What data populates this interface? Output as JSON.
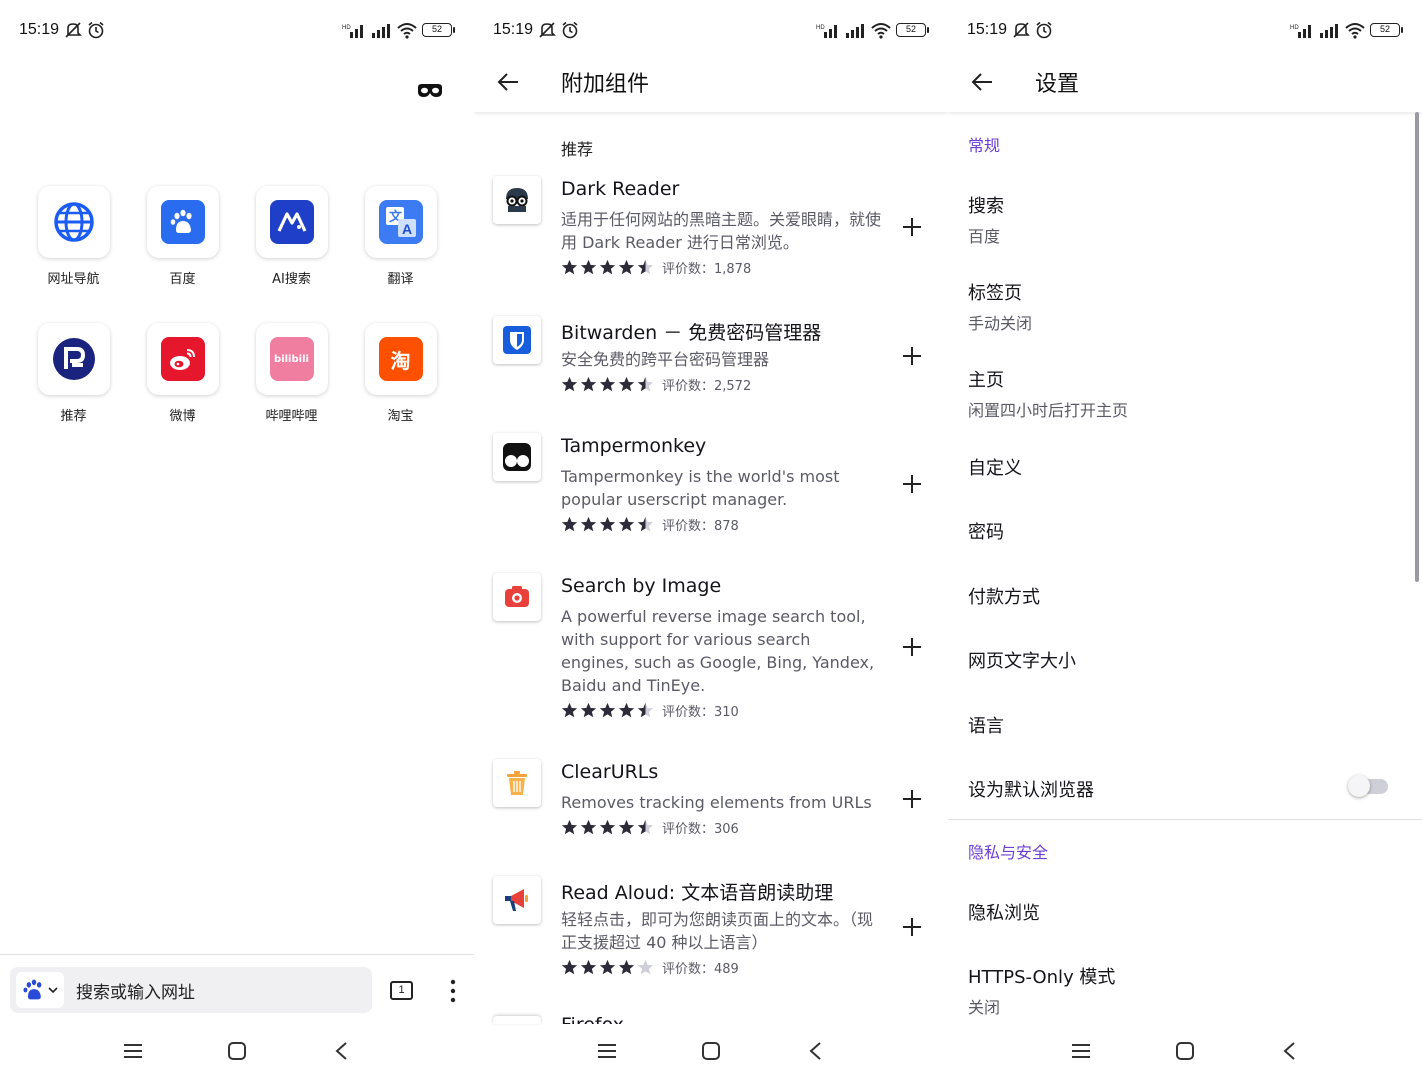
{
  "status_bar": {
    "time": "15:19",
    "battery": "52"
  },
  "home": {
    "shortcuts": [
      {
        "label": "网址导航",
        "icon": "globe-icon",
        "color": "#1a5cf5"
      },
      {
        "label": "百度",
        "icon": "baidu-paw-icon",
        "color": "#2a6cf0"
      },
      {
        "label": "AI搜索",
        "icon": "ai-search-icon",
        "color": "#1f3fc8"
      },
      {
        "label": "翻译",
        "icon": "translate-icon",
        "color": "#3d7bf2"
      },
      {
        "label": "推荐",
        "icon": "recommend-icon",
        "color": "#1a237e"
      },
      {
        "label": "微博",
        "icon": "weibo-icon",
        "color": "#e6162d"
      },
      {
        "label": "哔哩哔哩",
        "icon": "bilibili-icon",
        "color": "#f07ea0",
        "glyph": "bilibili"
      },
      {
        "label": "淘宝",
        "icon": "taobao-icon",
        "color": "#ff5000",
        "glyph": "淘"
      }
    ],
    "search_placeholder": "搜索或输入网址",
    "tab_count": "1"
  },
  "addons": {
    "title": "附加组件",
    "section": "推荐",
    "items": [
      {
        "name": "Dark Reader",
        "description": "适用于任何网站的黑暗主题。关爱眼睛，就使用 Dark Reader 进行日常浏览。",
        "rating_label": "评价数：1,878",
        "stars": 4.5,
        "icon": "dark-reader-icon"
      },
      {
        "name": "Bitwarden － 免费密码管理器",
        "description": "安全免费的跨平台密码管理器",
        "rating_label": "评价数：2,572",
        "stars": 4.5,
        "icon": "bitwarden-icon"
      },
      {
        "name": "Tampermonkey",
        "description": "Tampermonkey is the world's most popular userscript manager.",
        "rating_label": "评价数：878",
        "stars": 4.5,
        "icon": "tampermonkey-icon"
      },
      {
        "name": "Search by Image",
        "description": "A powerful reverse image search tool, with support for various search engines, such as Google, Bing, Yandex, Baidu and TinEye.",
        "rating_label": "评价数：310",
        "stars": 4.5,
        "icon": "camera-icon"
      },
      {
        "name": "ClearURLs",
        "description": "Removes tracking elements from URLs",
        "rating_label": "评价数：306",
        "stars": 4.5,
        "icon": "clearurls-icon"
      },
      {
        "name": "Read Aloud: 文本语音朗读助理",
        "description": "轻轻点击，即可为您朗读页面上的文本。（现正支援超过 40 种以上语言）",
        "rating_label": "评价数：489",
        "stars": 4,
        "icon": "megaphone-icon"
      }
    ],
    "next_item_partial": "Firefox Relay"
  },
  "settings": {
    "title": "设置",
    "general_header": "常规",
    "items": [
      {
        "title": "搜索",
        "subtitle": "百度"
      },
      {
        "title": "标签页",
        "subtitle": "手动关闭"
      },
      {
        "title": "主页",
        "subtitle": "闲置四小时后打开主页"
      },
      {
        "title": "自定义"
      },
      {
        "title": "密码"
      },
      {
        "title": "付款方式"
      },
      {
        "title": "网页文字大小"
      },
      {
        "title": "语言"
      },
      {
        "title": "设为默认浏览器",
        "toggle": false
      }
    ],
    "privacy_header": "隐私与安全",
    "privacy_items": [
      {
        "title": "隐私浏览"
      },
      {
        "title": "HTTPS-Only 模式",
        "subtitle": "关闭"
      }
    ],
    "accent_color": "#6b3fd4"
  }
}
